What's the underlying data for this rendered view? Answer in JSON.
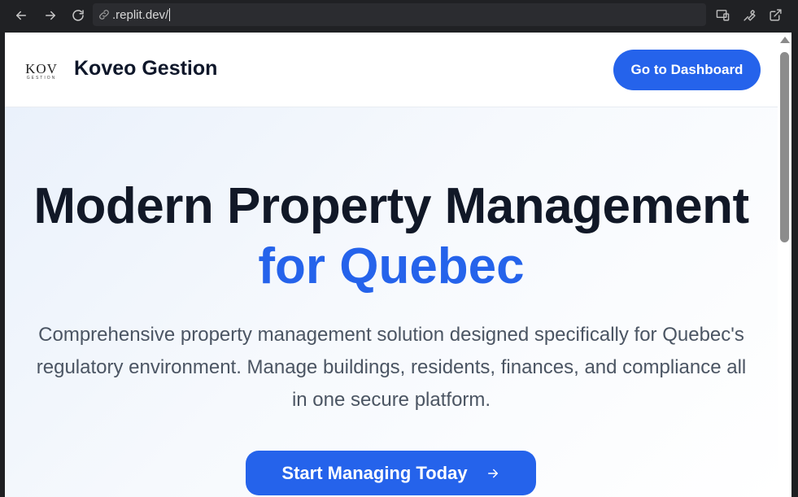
{
  "browser": {
    "url": ".replit.dev/",
    "icons": {
      "back": "arrow-left-icon",
      "forward": "arrow-right-icon",
      "reload": "reload-icon",
      "link": "link-icon",
      "devices": "devices-icon",
      "devtools": "wrench-icon",
      "open_external": "external-link-icon"
    }
  },
  "header": {
    "logo_main": "KOV",
    "logo_sub": "GESTION",
    "brand_name": "Koveo Gestion",
    "dashboard_button": "Go to Dashboard"
  },
  "hero": {
    "title_line1": "Modern Property Management",
    "title_line2": "for Quebec",
    "description": "Comprehensive property management solution designed specifically for Quebec's regulatory environment. Manage buildings, residents, finances, and compliance all in one secure platform.",
    "cta_label": "Start Managing Today",
    "cta_icon": "arrow-right-icon"
  },
  "colors": {
    "accent": "#2563eb",
    "heading": "#111827",
    "body_text": "#4b5563",
    "chrome_bg": "#202124"
  }
}
